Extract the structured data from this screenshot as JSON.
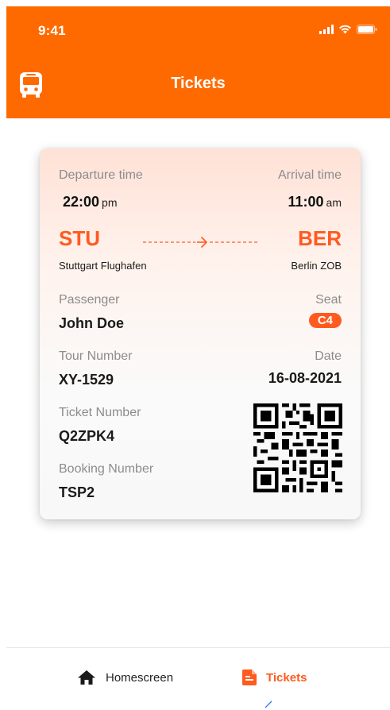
{
  "status_bar": {
    "time": "9:41",
    "icons": [
      "signal-icon",
      "wifi-icon",
      "battery-icon"
    ]
  },
  "header": {
    "title": "Tickets",
    "left_icon": "bus-icon"
  },
  "ticket": {
    "departure_label": "Departure time",
    "departure_time": "22:00",
    "departure_period": "pm",
    "arrival_label": "Arrival time",
    "arrival_time": "11:00",
    "arrival_period": "am",
    "origin_code": "STU",
    "origin_name": "Stuttgart Flughafen",
    "destination_code": "BER",
    "destination_name": "Berlin ZOB",
    "passenger_label": "Passenger",
    "passenger_name": "John Doe",
    "seat_label": "Seat",
    "seat_value": "C4",
    "tour_label": "Tour Number",
    "tour_value": "XY-1529",
    "date_label": "Date",
    "date_value": "16-08-2021",
    "ticket_label": "Ticket Number",
    "ticket_value": "Q2ZPK4",
    "booking_label": "Booking Number",
    "booking_value": "TSP2"
  },
  "tab_bar": {
    "tabs": [
      {
        "label": "Homescreen",
        "icon": "home-icon",
        "active": false
      },
      {
        "label": "Tickets",
        "icon": "document-icon",
        "active": true
      }
    ]
  },
  "colors": {
    "brand": "#FF6A00",
    "accent": "#FF5A1F",
    "text_dark": "#1a1a1a",
    "text_muted": "#8c8c8c"
  }
}
